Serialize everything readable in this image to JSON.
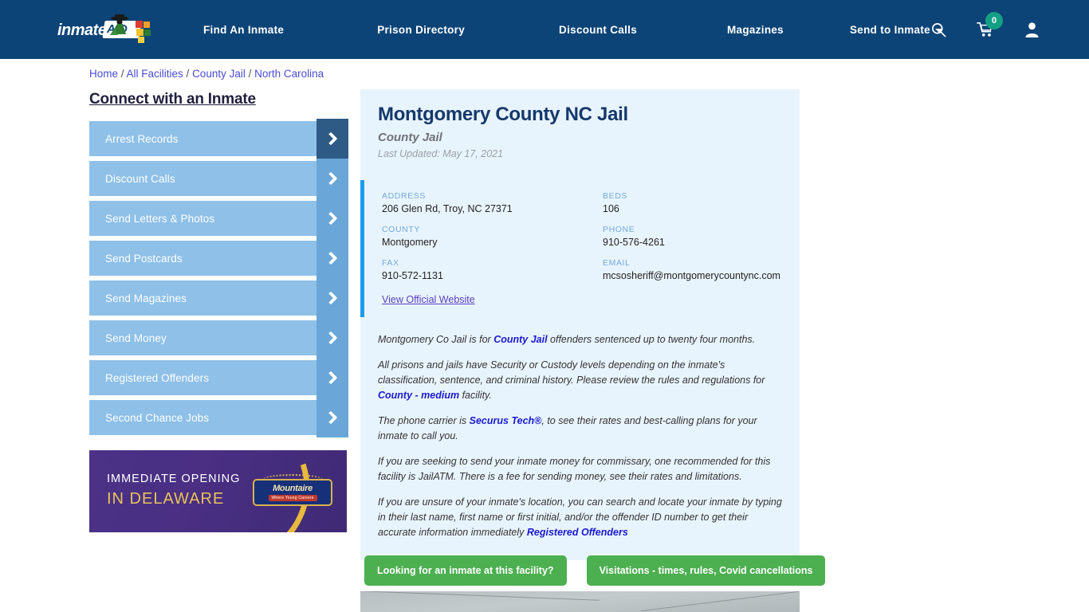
{
  "header": {
    "logo": {
      "name": "inmateAID",
      "part1": "inmate",
      "part2": "AID"
    },
    "nav": [
      {
        "label": "Find An Inmate",
        "name": "find-an-inmate"
      },
      {
        "label": "Prison Directory",
        "name": "prison-directory"
      },
      {
        "label": "Discount Calls",
        "name": "discount-calls"
      },
      {
        "label": "Magazines",
        "name": "magazines"
      },
      {
        "label": "Send to Inmate",
        "name": "send-to-inmate",
        "has_dropdown": true
      }
    ],
    "icons": {
      "search": "search-icon",
      "cart": "cart-icon",
      "cart_count": "0",
      "account": "user-account-icon"
    },
    "colors": {
      "background": "#0c4477",
      "badge": "#14a085"
    }
  },
  "breadcrumb": {
    "items": [
      "Home",
      "All Facilities",
      "County Jail",
      "North Carolina"
    ],
    "separator": "/"
  },
  "sidebar": {
    "title": "Connect with an Inmate",
    "items": [
      {
        "label": "Arrest Records",
        "active": true
      },
      {
        "label": "Discount Calls",
        "active": false
      },
      {
        "label": "Send Letters & Photos",
        "active": false
      },
      {
        "label": "Send Postcards",
        "active": false
      },
      {
        "label": "Send Magazines",
        "active": false
      },
      {
        "label": "Send Money",
        "active": false
      },
      {
        "label": "Registered Offenders",
        "active": false
      },
      {
        "label": "Second Chance Jobs",
        "active": false
      }
    ]
  },
  "ad": {
    "line1": "IMMEDIATE OPENING",
    "line2": "IN DELAWARE",
    "brand": "Mountaire",
    "brand_sub": "Where Young Careers",
    "colors": {
      "background": "#4b3287",
      "accent": "#e8c25a"
    }
  },
  "facility": {
    "title": "Montgomery County NC Jail",
    "type": "County Jail",
    "last_updated": "Last Updated: May 17, 2021",
    "info": {
      "address_label": "ADDRESS",
      "address_value": "206 Glen Rd, Troy, NC 27371",
      "beds_label": "BEDS",
      "beds_value": "106",
      "county_label": "COUNTY",
      "county_value": "Montgomery",
      "phone_label": "PHONE",
      "phone_value": "910-576-4261",
      "fax_label": "FAX",
      "fax_value": "910-572-1131",
      "email_label": "EMAIL",
      "email_value": "mcsosheriff@montgomerycountync.com",
      "official_website_link": "View Official Website"
    },
    "description": {
      "p1_a": "Montgomery Co Jail is for ",
      "p1_link": "County Jail",
      "p1_b": " offenders sentenced up to twenty four months.",
      "p2_a": "All prisons and jails have Security or Custody levels depending on the inmate's classification, sentence, and criminal history. Please review the rules and regulations for ",
      "p2_link": "County - medium",
      "p2_b": " facility.",
      "p3_a": "The phone carrier is ",
      "p3_link": "Securus Tech®",
      "p3_b": ", to see their rates and best-calling plans for your inmate to call you.",
      "p4": "If you are seeking to send your inmate money for commissary, one recommended for this facility is JailATM. There is a fee for sending money, see their rates and limitations.",
      "p5_a": "If you are unsure of your inmate's location, you can search and locate your inmate by typing in their last name, first name or first initial, and/or the offender ID number to get their accurate information immediately ",
      "p5_link": "Registered Offenders"
    }
  },
  "cta": {
    "buttons": [
      {
        "label": "Looking for an inmate at this facility?",
        "name": "looking-for-inmate-button"
      },
      {
        "label": "Visitations - times, rules, Covid cancellations",
        "name": "visitations-button"
      }
    ],
    "color": "#4caf50"
  }
}
